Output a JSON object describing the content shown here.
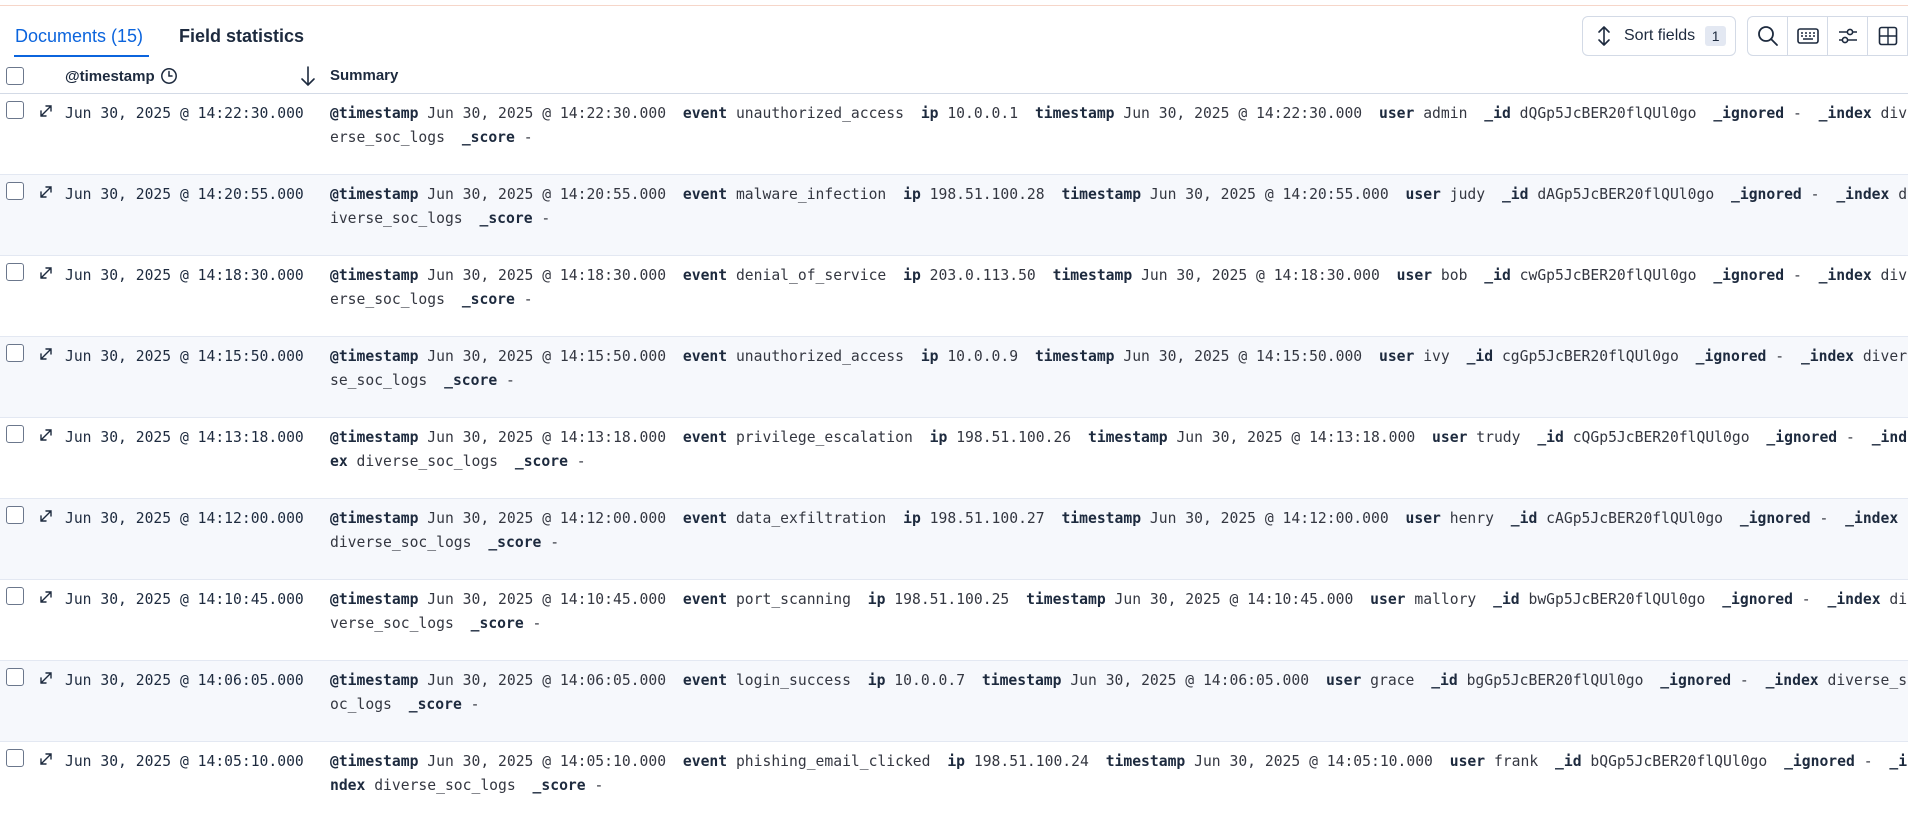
{
  "tabs": {
    "documents_label": "Documents (15)",
    "field_statistics_label": "Field statistics"
  },
  "toolbar": {
    "sort_fields_label": "Sort fields",
    "sort_fields_count": "1",
    "icons": [
      "search-icon",
      "keyboard-icon",
      "display-options-icon",
      "fullscreen-icon"
    ]
  },
  "columns": {
    "timestamp_header": "@timestamp",
    "summary_header": "Summary",
    "timestamp_sort": "descending"
  },
  "colors": {
    "accent": "#0b64dd",
    "row_alt": "#f6f8fc",
    "border": "#d3dae6"
  },
  "rows": [
    {
      "timestamp": "Jun 30, 2025 @ 14:22:30.000",
      "event": "unauthorized_access",
      "ip": "10.0.0.1",
      "user": "admin",
      "id": "dQGp5JcBER20flQUl0go",
      "ignored": "-",
      "index": "diverse_soc_logs",
      "score": "-"
    },
    {
      "timestamp": "Jun 30, 2025 @ 14:20:55.000",
      "event": "malware_infection",
      "ip": "198.51.100.28",
      "user": "judy",
      "id": "dAGp5JcBER20flQUl0go",
      "ignored": "-",
      "index": "diverse_soc_logs",
      "score": "-"
    },
    {
      "timestamp": "Jun 30, 2025 @ 14:18:30.000",
      "event": "denial_of_service",
      "ip": "203.0.113.50",
      "user": "bob",
      "id": "cwGp5JcBER20flQUl0go",
      "ignored": "-",
      "index": "diverse_soc_logs",
      "score": "-"
    },
    {
      "timestamp": "Jun 30, 2025 @ 14:15:50.000",
      "event": "unauthorized_access",
      "ip": "10.0.0.9",
      "user": "ivy",
      "id": "cgGp5JcBER20flQUl0go",
      "ignored": "-",
      "index": "diverse_soc_logs",
      "score": "-"
    },
    {
      "timestamp": "Jun 30, 2025 @ 14:13:18.000",
      "event": "privilege_escalation",
      "ip": "198.51.100.26",
      "user": "trudy",
      "id": "cQGp5JcBER20flQUl0go",
      "ignored": "-",
      "index": "diverse_soc_logs",
      "score": "-"
    },
    {
      "timestamp": "Jun 30, 2025 @ 14:12:00.000",
      "event": "data_exfiltration",
      "ip": "198.51.100.27",
      "user": "henry",
      "id": "cAGp5JcBER20flQUl0go",
      "ignored": "-",
      "index": "diverse_soc_logs",
      "score": "-"
    },
    {
      "timestamp": "Jun 30, 2025 @ 14:10:45.000",
      "event": "port_scanning",
      "ip": "198.51.100.25",
      "user": "mallory",
      "id": "bwGp5JcBER20flQUl0go",
      "ignored": "-",
      "index": "diverse_soc_logs",
      "score": "-"
    },
    {
      "timestamp": "Jun 30, 2025 @ 14:06:05.000",
      "event": "login_success",
      "ip": "10.0.0.7",
      "user": "grace",
      "id": "bgGp5JcBER20flQUl0go",
      "ignored": "-",
      "index": "diverse_soc_logs",
      "score": "-"
    },
    {
      "timestamp": "Jun 30, 2025 @ 14:05:10.000",
      "event": "phishing_email_clicked",
      "ip": "198.51.100.24",
      "user": "frank",
      "id": "bQGp5JcBER20flQUl0go",
      "ignored": "-",
      "index": "diverse_soc_logs",
      "score": "-"
    }
  ]
}
